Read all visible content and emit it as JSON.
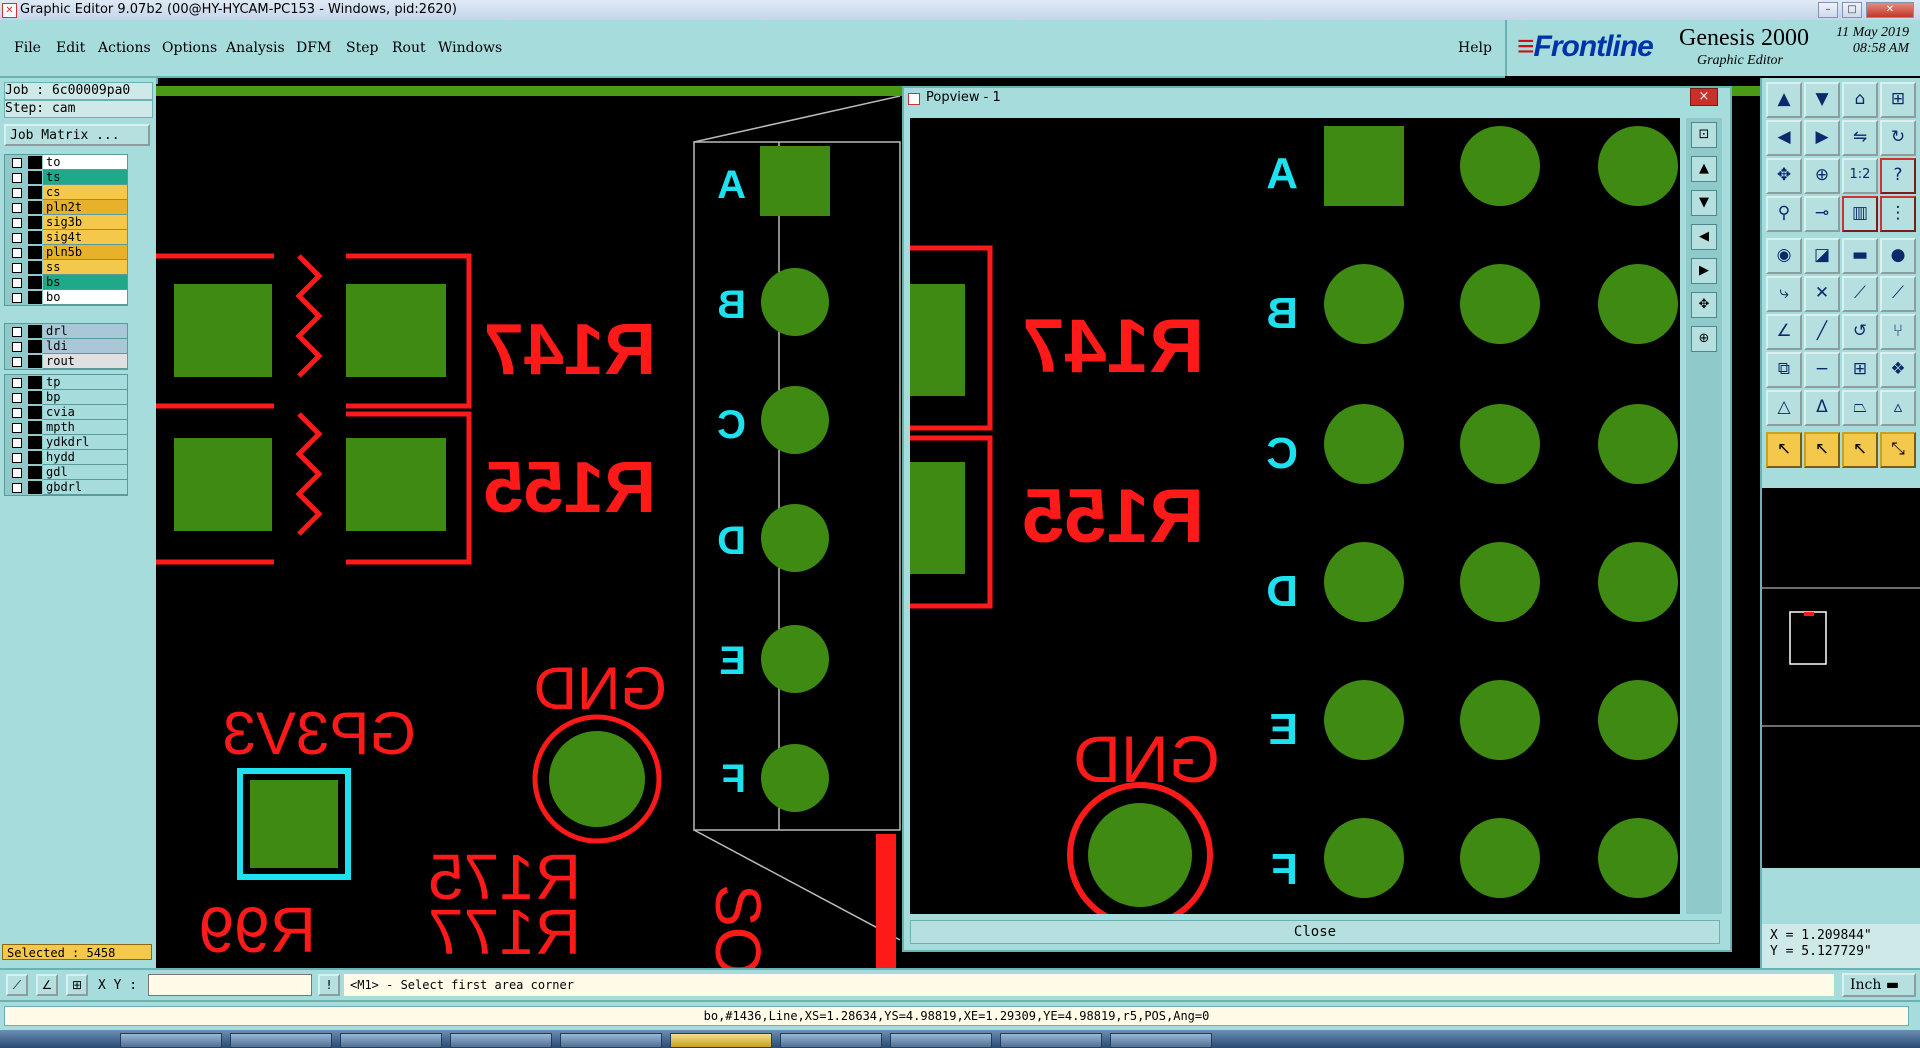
{
  "window": {
    "title": "Graphic Editor 9.07b2 (00@HY-HYCAM-PC153 - Windows, pid:2620)"
  },
  "menu": {
    "items": [
      "File",
      "Edit",
      "Actions",
      "Options",
      "Analysis",
      "DFM",
      "Step",
      "Rout",
      "Windows"
    ],
    "help": "Help"
  },
  "brand": {
    "logo": "Frontline",
    "product": "Genesis 2000",
    "subtitle": "Graphic Editor",
    "date": "11 May 2019",
    "time": "08:58 AM"
  },
  "job": {
    "job_label": "Job : 6c00009pa0",
    "step_label": "Step: cam",
    "matrix_button": "Job Matrix ..."
  },
  "layers": {
    "board": [
      {
        "name": "to",
        "color": "#ffffff"
      },
      {
        "name": "ts",
        "color": "#1fa88a"
      },
      {
        "name": "cs",
        "color": "#f4c84a"
      },
      {
        "name": "pln2t",
        "color": "#e8b12a"
      },
      {
        "name": "sig3b",
        "color": "#f4c84a"
      },
      {
        "name": "sig4t",
        "color": "#f4c84a"
      },
      {
        "name": "pln5b",
        "color": "#e8b12a"
      },
      {
        "name": "ss",
        "color": "#f4c84a"
      },
      {
        "name": "bs",
        "color": "#1fa88a"
      },
      {
        "name": "bo",
        "color": "#ffffff"
      }
    ],
    "drill": [
      {
        "name": "drl",
        "color": "#a9c7d6"
      },
      {
        "name": "ldi",
        "color": "#a9c7d6"
      },
      {
        "name": "rout",
        "color": "#e0e0e0"
      }
    ],
    "misc": [
      {
        "name": "tp",
        "color": "#a7dcdc"
      },
      {
        "name": "bp",
        "color": "#a7dcdc"
      },
      {
        "name": "cvia",
        "color": "#a7dcdc"
      },
      {
        "name": "mpth",
        "color": "#a7dcdc"
      },
      {
        "name": "ydkdrl",
        "color": "#a7dcdc"
      },
      {
        "name": "hydd",
        "color": "#a7dcdc"
      },
      {
        "name": "gdl",
        "color": "#a7dcdc"
      },
      {
        "name": "gbdrl",
        "color": "#a7dcdc"
      }
    ]
  },
  "selected": "Selected : 5458",
  "canvas_labels": {
    "r147": "R147",
    "r155": "R155",
    "gnd": "GND",
    "gp3v3": "GP3V3",
    "r175": "R175",
    "r177": "R177",
    "r99": "R99",
    "sot": "SOT",
    "rows": [
      "A",
      "B",
      "C",
      "D",
      "E",
      "F"
    ]
  },
  "popview": {
    "title": "Popview - 1",
    "close_x": "×",
    "close_button": "Close"
  },
  "coordinates": {
    "x": "X = 1.209844\"",
    "y": "Y = 5.127729\""
  },
  "command": {
    "xy_label": "X Y :",
    "xy_value": "",
    "prompt": "<M1> - Select first area corner",
    "units": "Inch"
  },
  "status": "bo,#1436,Line,XS=1.28634,YS=4.98819,XE=1.29309,YE=4.98819,r5,POS,Ang=0",
  "colors": {
    "ui_teal": "#a7dcdc",
    "copper_green": "#3f8a12",
    "silk_red": "#ff1a1a",
    "label_cyan": "#1ee1f0"
  }
}
